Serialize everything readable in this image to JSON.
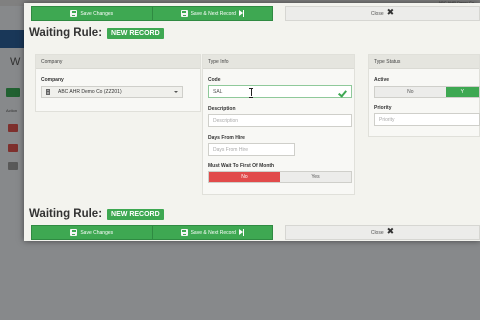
{
  "background": {
    "title": "W",
    "actions_label": "Action",
    "topright": "ABC AHR Demo Co"
  },
  "toolbar": {
    "save_label": "Save Changes",
    "save_next_label": "Save & Next Record",
    "close_label": "Close"
  },
  "heading": {
    "title": "Waiting Rule:",
    "badge": "NEW RECORD"
  },
  "company": {
    "header": "Company",
    "field_label": "Company",
    "selected": "ABC AHR Demo Co (ZZ201)"
  },
  "type_info": {
    "header": "Type Info",
    "code_label": "Code",
    "code_value": "SAL",
    "description_label": "Description",
    "description_placeholder": "Description",
    "days_label": "Days From Hire",
    "days_placeholder": "Days From Hire",
    "wait_label": "Must Wait To First Of Month",
    "wait_no": "No",
    "wait_yes": "Yes"
  },
  "type_status": {
    "header": "Type Status",
    "active_label": "Active",
    "active_no": "No",
    "active_yes": "Y",
    "priority_label": "Priority",
    "priority_placeholder": "Priority"
  },
  "colors": {
    "green": "#3ea852",
    "red": "#e14b4b",
    "panel": "#f3f3ee"
  }
}
